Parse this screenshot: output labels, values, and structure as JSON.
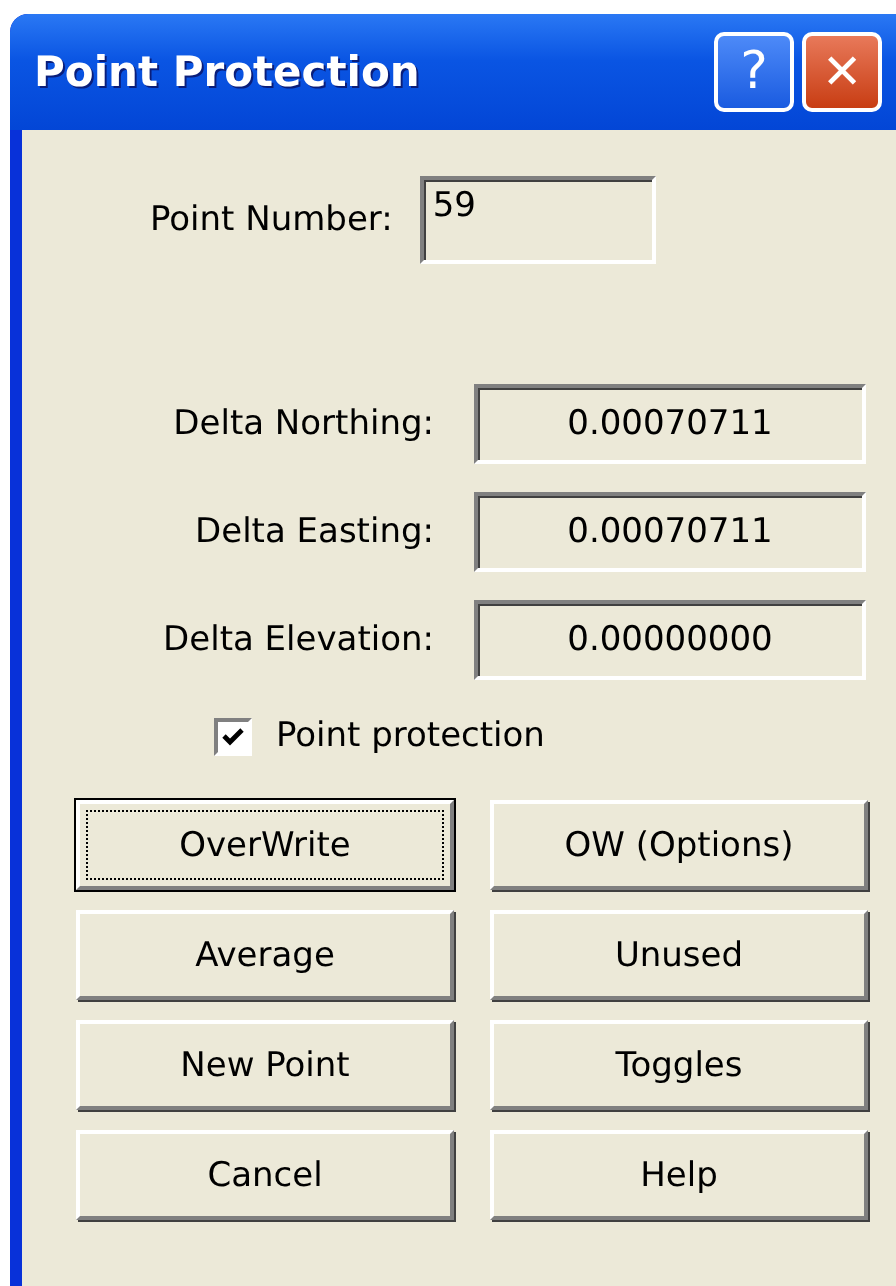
{
  "window": {
    "title": "Point Protection",
    "title_buttons": [
      {
        "kind": "help",
        "label": "?"
      },
      {
        "kind": "close",
        "label": "✕"
      }
    ]
  },
  "point_number": {
    "label": "Point Number:",
    "value": "59"
  },
  "deltas": [
    {
      "label": "Delta Northing:",
      "value": "0.00070711"
    },
    {
      "label": "Delta Easting:",
      "value": "0.00070711"
    },
    {
      "label": "Delta Elevation:",
      "value": "0.00000000"
    }
  ],
  "point_protection": {
    "label": "Point protection",
    "checked": true
  },
  "buttons": [
    {
      "label": "OverWrite",
      "focused": true
    },
    {
      "label": "OW (Options)",
      "focused": false
    },
    {
      "label": "Average",
      "focused": false
    },
    {
      "label": "Unused",
      "focused": false
    },
    {
      "label": "New Point",
      "focused": false
    },
    {
      "label": "Toggles",
      "focused": false
    },
    {
      "label": "Cancel",
      "focused": false
    },
    {
      "label": "Help",
      "focused": false
    }
  ]
}
